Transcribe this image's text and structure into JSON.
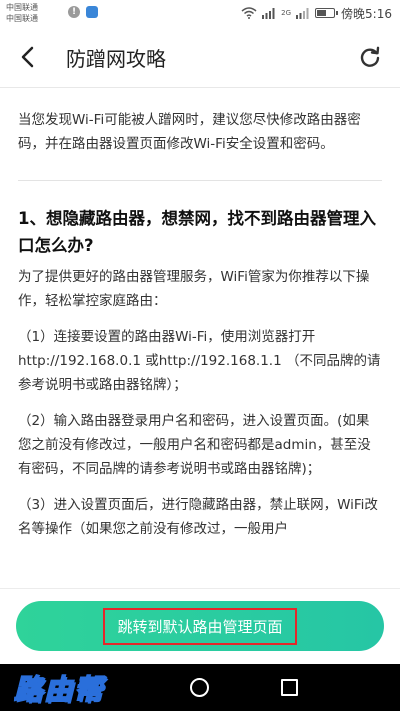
{
  "status_bar": {
    "carrier_1": "中国联通",
    "carrier_2": "中国联通",
    "network_label": "2G",
    "time": "傍晚5:16"
  },
  "app_bar": {
    "title": "防蹭网攻略",
    "back_icon": "back-arrow-icon",
    "refresh_icon": "refresh-icon"
  },
  "content": {
    "intro": "当您发现Wi-Fi可能被人蹭网时，建议您尽快修改路由器密码，并在路由器设置页面修改Wi-Fi安全设置和密码。",
    "section_title": "1、想隐藏路由器，想禁网，找不到路由器管理入口怎么办?",
    "section_intro": "为了提供更好的路由器管理服务，WiFi管家为你推荐以下操作，轻松掌控家庭路由：",
    "steps": [
      "（1）连接要设置的路由器Wi-Fi，使用浏览器打开http://192.168.0.1 或http://192.168.1.1 （不同品牌的请参考说明书或路由器铭牌）；",
      "（2）输入路由器登录用户名和密码，进入设置页面。(如果您之前没有修改过，一般用户名和密码都是admin，甚至没有密码，不同品牌的请参考说明书或路由器铭牌)；",
      "（3）进入设置页面后，进行隐藏路由器，禁止联网，WiFi改名等操作（如果您之前没有修改过，一般用户"
    ]
  },
  "cta": {
    "label": "跳转到默认路由管理页面",
    "button_color": "#2fd39a",
    "highlight_color": "#e4282b"
  },
  "nav_bar": {
    "watermark": "路由帮"
  }
}
